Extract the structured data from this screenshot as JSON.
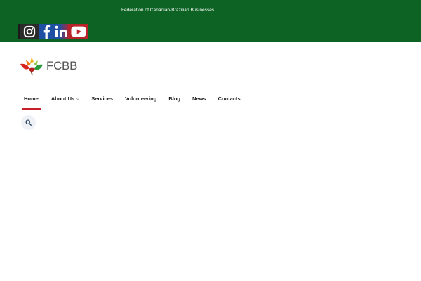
{
  "topbar": {
    "tagline": "Federation of Canadian-Brazilian Businesses",
    "background_color": "#0c6323",
    "social": [
      {
        "name": "instagram",
        "icon": "instagram-icon",
        "color": "#2b2b2b"
      },
      {
        "name": "facebook",
        "icon": "facebook-icon",
        "color": "#1f4fa3"
      },
      {
        "name": "linkedin",
        "icon": "linkedin-icon",
        "color": "#1f4fa3"
      },
      {
        "name": "youtube",
        "icon": "youtube-icon",
        "color": "#b9232a"
      }
    ]
  },
  "brand": {
    "name": "FCBB",
    "logo_icon": "maple-leaf-logo-icon"
  },
  "nav": {
    "items": [
      {
        "label": "Home",
        "active": true
      },
      {
        "label": "About Us",
        "has_dropdown": true
      },
      {
        "label": "Services"
      },
      {
        "label": "Volunteering"
      },
      {
        "label": "Blog"
      },
      {
        "label": "News"
      },
      {
        "label": "Contacts"
      }
    ],
    "active_color": "#c8202a"
  },
  "search": {
    "icon": "search-icon"
  }
}
